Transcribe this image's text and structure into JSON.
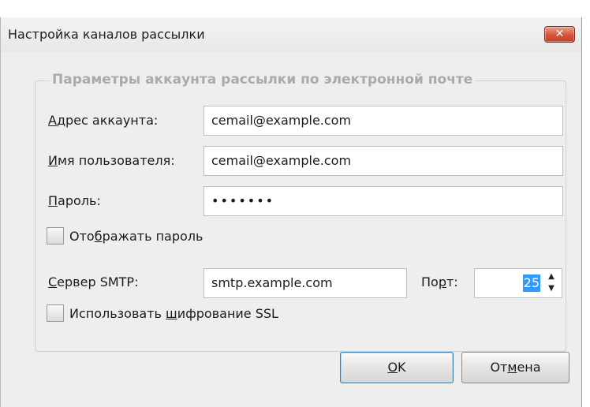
{
  "dialog": {
    "title": "Настройка каналов рассылки",
    "close_icon": "close-icon"
  },
  "group": {
    "legend": "Параметры аккаунта рассылки по электронной почте"
  },
  "fields": {
    "account_address": {
      "label_accel": "А",
      "label_rest": "дрес аккаунта:",
      "value": "cemail@example.com"
    },
    "username": {
      "label_accel": "И",
      "label_rest": "мя пользователя:",
      "value": "cemail@example.com"
    },
    "password": {
      "label_accel": "П",
      "label_rest": "ароль:",
      "value": "•••••••"
    },
    "smtp_server": {
      "label_accel": "С",
      "label_rest": "ервер SMTP:",
      "value": "smtp.example.com"
    },
    "port": {
      "label_pre": "По",
      "label_accel": "р",
      "label_rest": "т:",
      "value": "25"
    }
  },
  "checkboxes": {
    "show_password": {
      "label_pre": "Ото",
      "label_accel": "б",
      "label_rest": "ражать пароль",
      "checked": false
    },
    "use_ssl": {
      "label_pre": "Использовать ",
      "label_accel": "ш",
      "label_rest": "ифрование SSL",
      "checked": false
    }
  },
  "buttons": {
    "ok": {
      "label_accel": "О",
      "label_rest": "K"
    },
    "cancel": {
      "label_pre": "От",
      "label_accel": "м",
      "label_rest": "ена"
    }
  }
}
